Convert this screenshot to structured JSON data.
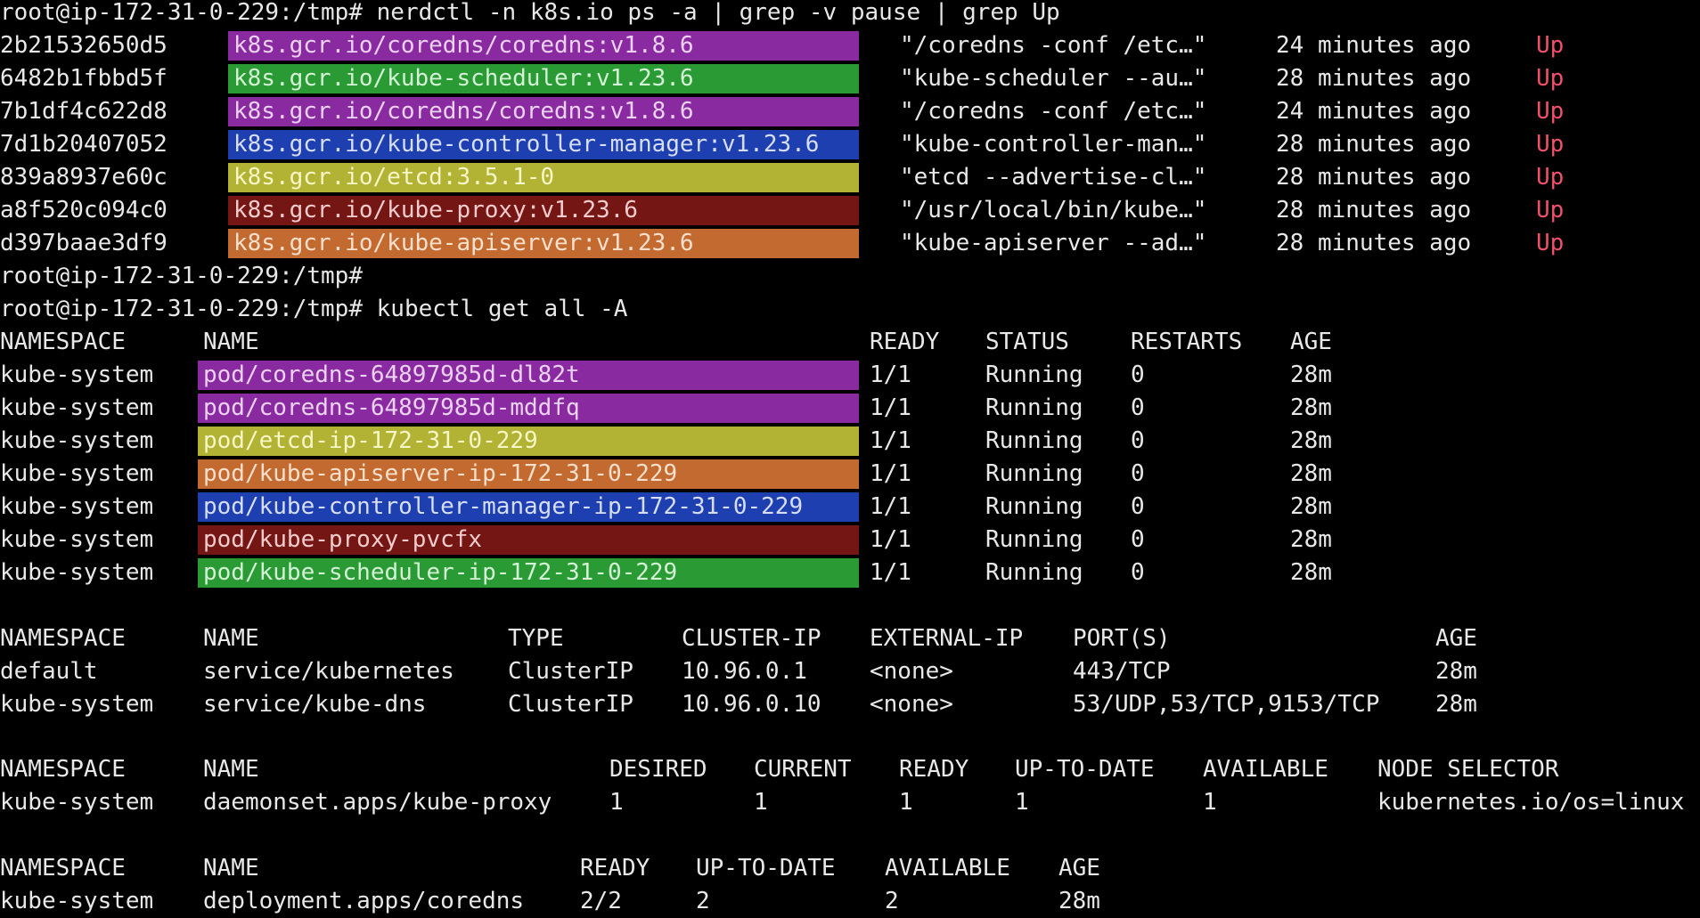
{
  "colors": {
    "background": "#000000",
    "text": "#e8e8e8",
    "up_status": "#f0506a",
    "highlight_purple": "#8a2aa0",
    "highlight_green": "#2a9a34",
    "highlight_blue": "#1e3fb0",
    "highlight_yellow": "#b2b234",
    "highlight_dark_red": "#741614",
    "highlight_orange": "#c26a30"
  },
  "prompt1": "root@ip-172-31-0-229:/tmp# nerdctl -n k8s.io ps -a | grep -v pause | grep Up",
  "containers": [
    {
      "id": "2b21532650d5",
      "image": "k8s.gcr.io/coredns/coredns:v1.8.6",
      "command": "\"/coredns -conf /etc…\"",
      "created": "24 minutes ago",
      "status": "Up"
    },
    {
      "id": "6482b1fbbd5f",
      "image": "k8s.gcr.io/kube-scheduler:v1.23.6",
      "command": "\"kube-scheduler --au…\"",
      "created": "28 minutes ago",
      "status": "Up"
    },
    {
      "id": "7b1df4c622d8",
      "image": "k8s.gcr.io/coredns/coredns:v1.8.6",
      "command": "\"/coredns -conf /etc…\"",
      "created": "24 minutes ago",
      "status": "Up"
    },
    {
      "id": "7d1b20407052",
      "image": "k8s.gcr.io/kube-controller-manager:v1.23.6",
      "command": "\"kube-controller-man…\"",
      "created": "28 minutes ago",
      "status": "Up"
    },
    {
      "id": "839a8937e60c",
      "image": "k8s.gcr.io/etcd:3.5.1-0",
      "command": "\"etcd --advertise-cl…\"",
      "created": "28 minutes ago",
      "status": "Up"
    },
    {
      "id": "a8f520c094c0",
      "image": "k8s.gcr.io/kube-proxy:v1.23.6",
      "command": "\"/usr/local/bin/kube…\"",
      "created": "28 minutes ago",
      "status": "Up"
    },
    {
      "id": "d397baae3df9",
      "image": "k8s.gcr.io/kube-apiserver:v1.23.6",
      "command": "\"kube-apiserver --ad…\"",
      "created": "28 minutes ago",
      "status": "Up"
    }
  ],
  "prompt2": "root@ip-172-31-0-229:/tmp#",
  "prompt3": "root@ip-172-31-0-229:/tmp# kubectl get all -A",
  "pods": {
    "headers": {
      "namespace": "NAMESPACE",
      "name": "NAME",
      "ready": "READY",
      "status": "STATUS",
      "restarts": "RESTARTS",
      "age": "AGE"
    },
    "rows": [
      {
        "namespace": "kube-system",
        "name": "pod/coredns-64897985d-dl82t",
        "ready": "1/1",
        "status": "Running",
        "restarts": "0",
        "age": "28m"
      },
      {
        "namespace": "kube-system",
        "name": "pod/coredns-64897985d-mddfq",
        "ready": "1/1",
        "status": "Running",
        "restarts": "0",
        "age": "28m"
      },
      {
        "namespace": "kube-system",
        "name": "pod/etcd-ip-172-31-0-229",
        "ready": "1/1",
        "status": "Running",
        "restarts": "0",
        "age": "28m"
      },
      {
        "namespace": "kube-system",
        "name": "pod/kube-apiserver-ip-172-31-0-229",
        "ready": "1/1",
        "status": "Running",
        "restarts": "0",
        "age": "28m"
      },
      {
        "namespace": "kube-system",
        "name": "pod/kube-controller-manager-ip-172-31-0-229",
        "ready": "1/1",
        "status": "Running",
        "restarts": "0",
        "age": "28m"
      },
      {
        "namespace": "kube-system",
        "name": "pod/kube-proxy-pvcfx",
        "ready": "1/1",
        "status": "Running",
        "restarts": "0",
        "age": "28m"
      },
      {
        "namespace": "kube-system",
        "name": "pod/kube-scheduler-ip-172-31-0-229",
        "ready": "1/1",
        "status": "Running",
        "restarts": "0",
        "age": "28m"
      }
    ]
  },
  "services": {
    "headers": {
      "namespace": "NAMESPACE",
      "name": "NAME",
      "type": "TYPE",
      "cluster_ip": "CLUSTER-IP",
      "external_ip": "EXTERNAL-IP",
      "ports": "PORT(S)",
      "age": "AGE"
    },
    "rows": [
      {
        "namespace": "default",
        "name": "service/kubernetes",
        "type": "ClusterIP",
        "cluster_ip": "10.96.0.1",
        "external_ip": "<none>",
        "ports": "443/TCP",
        "age": "28m"
      },
      {
        "namespace": "kube-system",
        "name": "service/kube-dns",
        "type": "ClusterIP",
        "cluster_ip": "10.96.0.10",
        "external_ip": "<none>",
        "ports": "53/UDP,53/TCP,9153/TCP",
        "age": "28m"
      }
    ]
  },
  "daemonsets": {
    "headers": {
      "namespace": "NAMESPACE",
      "name": "NAME",
      "desired": "DESIRED",
      "current": "CURRENT",
      "ready": "READY",
      "up_to_date": "UP-TO-DATE",
      "available": "AVAILABLE",
      "node_selector": "NODE SELECTOR"
    },
    "rows": [
      {
        "namespace": "kube-system",
        "name": "daemonset.apps/kube-proxy",
        "desired": "1",
        "current": "1",
        "ready": "1",
        "up_to_date": "1",
        "available": "1",
        "node_selector": "kubernetes.io/os=linux"
      }
    ]
  },
  "deployments": {
    "headers": {
      "namespace": "NAMESPACE",
      "name": "NAME",
      "ready": "READY",
      "up_to_date": "UP-TO-DATE",
      "available": "AVAILABLE",
      "age": "AGE"
    },
    "rows": [
      {
        "namespace": "kube-system",
        "name": "deployment.apps/coredns",
        "ready": "2/2",
        "up_to_date": "2",
        "available": "2",
        "age": "28m"
      }
    ]
  }
}
